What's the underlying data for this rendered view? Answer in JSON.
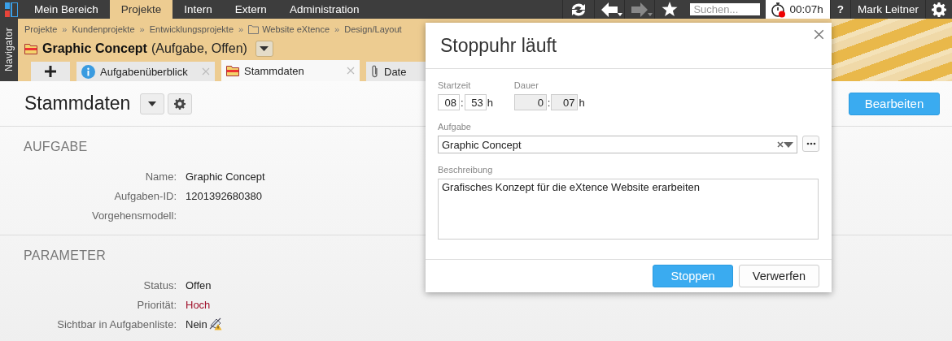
{
  "topbar": {
    "menu": [
      {
        "label": "Mein Bereich",
        "selected": false
      },
      {
        "label": "Projekte",
        "selected": true
      },
      {
        "label": "Intern",
        "selected": false
      },
      {
        "label": "Extern",
        "selected": false
      },
      {
        "label": "Administration",
        "selected": false
      }
    ],
    "nav_buttons": [
      {
        "kind": "refresh",
        "disabled": false
      },
      {
        "kind": "back",
        "disabled": false
      },
      {
        "kind": "forward",
        "disabled": true
      },
      {
        "kind": "favorite",
        "disabled": false
      }
    ],
    "search": {
      "placeholder": "Suchen..."
    },
    "timer": {
      "value": "00:07h",
      "running": true
    },
    "help": "?",
    "user": "Mark Leitner"
  },
  "navigator": {
    "label": "Navigator"
  },
  "header": {
    "breadcrumb": [
      {
        "label": "Projekte",
        "kind": "plain"
      },
      {
        "label": "Kundenprojekte",
        "kind": "plain",
        "separator": "»"
      },
      {
        "label": "Entwicklungsprojekte",
        "kind": "plain",
        "separator": "»"
      },
      {
        "label": "Website eXtence",
        "kind": "folder",
        "separator": "»"
      },
      {
        "label": "Design/Layout",
        "kind": "plain",
        "separator": "»"
      }
    ],
    "title": "Graphic Concept",
    "subtitle": "(Aufgabe, Offen)",
    "tabs": [
      {
        "kind": "add",
        "selected": false
      },
      {
        "kind": "info",
        "label": "Aufgabenüberblick",
        "selected": false
      },
      {
        "kind": "task",
        "label": "Stammdaten",
        "selected": true
      },
      {
        "kind": "attachment",
        "label": "Date",
        "selected": false
      }
    ]
  },
  "content": {
    "title": "Stammdaten",
    "primary_action": "Bearbeiten",
    "sections": [
      {
        "title": "AUFGABE",
        "rows": [
          {
            "label": "Name:",
            "value": "Graphic Concept",
            "kind": "text",
            "emphasis": false
          },
          {
            "label": "Aufgaben-ID:",
            "value": "1201392680380",
            "kind": "text",
            "emphasis": false
          },
          {
            "label": "Vorgehensmodell:",
            "kind": "text",
            "emphasis": false
          }
        ]
      },
      {
        "title": "PARAMETER",
        "rows": [
          {
            "label": "Status:",
            "value": "Offen",
            "kind": "text",
            "emphasis": false
          },
          {
            "label": "Priorität:",
            "value": "Hoch",
            "kind": "text",
            "emphasis": true
          },
          {
            "label": "Sichtbar in Aufgabenliste:",
            "value": "Nein",
            "kind": "flag",
            "emphasis": false
          }
        ]
      }
    ]
  },
  "dialog": {
    "title": "Stoppuhr läuft",
    "start": {
      "label": "Startzeit",
      "hour": "08",
      "separator": ":",
      "minute": "53",
      "unit": "h",
      "disabled": false
    },
    "duration": {
      "label": "Dauer",
      "hour": "0",
      "separator": ":",
      "minute": "07",
      "unit": "h",
      "disabled": true
    },
    "task": {
      "label": "Aufgabe",
      "value": "Graphic Concept"
    },
    "description": {
      "label": "Beschreibung",
      "value": "Grafisches Konzept für die eXtence Website erarbeiten"
    },
    "buttons": [
      {
        "label": "Stoppen",
        "kind": "primary"
      },
      {
        "label": "Verwerfen",
        "kind": "secondary"
      }
    ]
  }
}
